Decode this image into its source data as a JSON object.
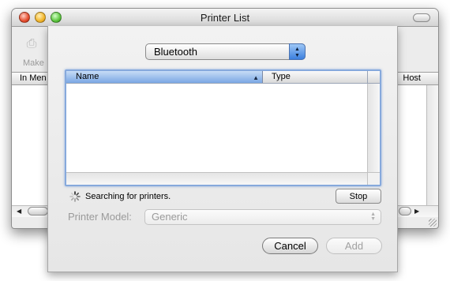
{
  "window": {
    "title": "Printer List",
    "toolbar_partial_label": "Make",
    "list_header_left": "In Men",
    "list_header_right": "Host"
  },
  "sheet": {
    "connection_popup": {
      "selected": "Bluetooth"
    },
    "table": {
      "columns": [
        "Name",
        "Type"
      ],
      "sorted_column": "Name",
      "sort_direction": "ascending",
      "rows": []
    },
    "status_text": "Searching for printers.",
    "stop_button": "Stop",
    "printer_model": {
      "label": "Printer Model:",
      "selected": "Generic",
      "enabled": false
    },
    "buttons": {
      "cancel": "Cancel",
      "add": "Add",
      "add_enabled": false
    }
  },
  "colors": {
    "accent": "#3b7fde",
    "focus_ring": "#86a9dc",
    "disabled_text": "#9a9a9a"
  }
}
